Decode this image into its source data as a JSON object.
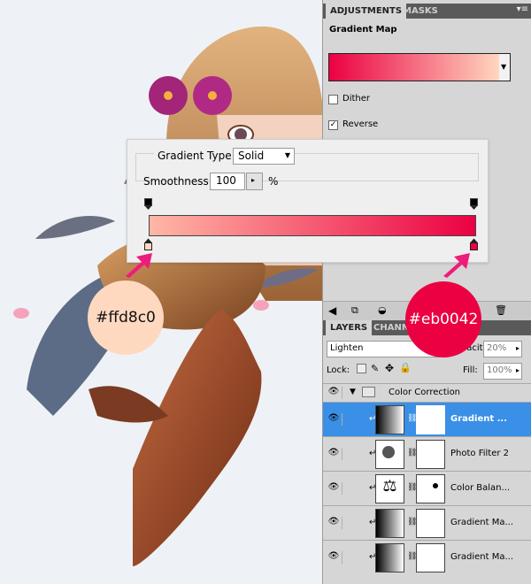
{
  "adjustments_panel": {
    "tabs": [
      {
        "label": "ADJUSTMENTS",
        "active": true
      },
      {
        "label": "MASKS",
        "active": false
      }
    ],
    "title": "Gradient Map",
    "gradient": {
      "from": "#eb0042",
      "to": "#ffd8c0"
    },
    "dither": {
      "label": "Dither",
      "checked": false
    },
    "reverse": {
      "label": "Reverse",
      "checked": true
    }
  },
  "gradient_editor": {
    "gradient_type_label": "Gradient Type:",
    "gradient_type_value": "Solid",
    "smoothness_label": "Smoothness:",
    "smoothness_value": "100",
    "smoothness_unit": "%",
    "ramp": {
      "from": "#ffb7a5",
      "to": "#eb0042"
    }
  },
  "callouts": {
    "left_color": "#ffd8c0",
    "right_color": "#eb0042",
    "arrow_color": "#ee1c7b"
  },
  "layers_panel": {
    "tabs": [
      "LAYERS",
      "CHANN"
    ],
    "blend_mode": "Lighten",
    "opacity_label": "Opacity:",
    "opacity_value": "20%",
    "lock_label": "Lock:",
    "fill_label": "Fill:",
    "fill_value": "100%",
    "group_name": "Color Correction",
    "layers": [
      {
        "name": "Gradient ...",
        "icon": "gradient-map-icon",
        "selected": true
      },
      {
        "name": "Photo Filter 2",
        "icon": "photo-filter-icon",
        "selected": false
      },
      {
        "name": "Color Balan...",
        "icon": "color-balance-icon",
        "selected": false
      },
      {
        "name": "Gradient Ma...",
        "icon": "gradient-map-icon",
        "selected": false
      },
      {
        "name": "Gradient Ma...",
        "icon": "gradient-map-icon",
        "selected": false
      }
    ]
  }
}
